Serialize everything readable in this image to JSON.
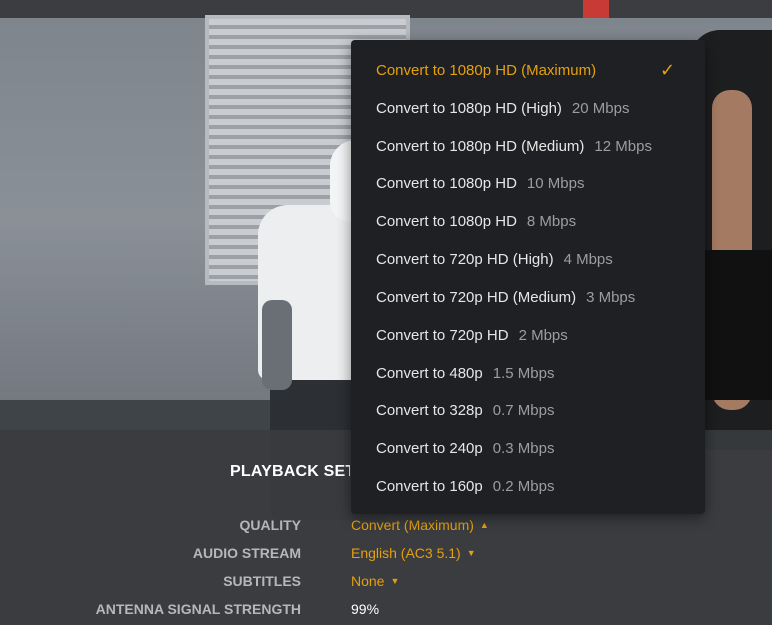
{
  "panel": {
    "title": "PLAYBACK SETTINGS",
    "rows": [
      {
        "label": "QUALITY",
        "value": "Convert (Maximum)",
        "caret": "up"
      },
      {
        "label": "AUDIO STREAM",
        "value": "English (AC3 5.1)",
        "caret": "down"
      },
      {
        "label": "SUBTITLES",
        "value": "None",
        "caret": "down"
      },
      {
        "label": "ANTENNA SIGNAL STRENGTH",
        "value": "99%"
      }
    ]
  },
  "quality_menu": {
    "items": [
      {
        "label": "Convert to 1080p HD (Maximum)",
        "rate": "",
        "selected": true
      },
      {
        "label": "Convert to 1080p HD (High)",
        "rate": "20 Mbps"
      },
      {
        "label": "Convert to 1080p HD (Medium)",
        "rate": "12 Mbps"
      },
      {
        "label": "Convert to 1080p HD",
        "rate": "10 Mbps"
      },
      {
        "label": "Convert to 1080p HD",
        "rate": "8 Mbps"
      },
      {
        "label": "Convert to 720p HD (High)",
        "rate": "4 Mbps"
      },
      {
        "label": "Convert to 720p HD (Medium)",
        "rate": "3 Mbps"
      },
      {
        "label": "Convert to 720p HD",
        "rate": "2 Mbps"
      },
      {
        "label": "Convert to 480p",
        "rate": "1.5 Mbps"
      },
      {
        "label": "Convert to 328p",
        "rate": "0.7 Mbps"
      },
      {
        "label": "Convert to 240p",
        "rate": "0.3 Mbps"
      },
      {
        "label": "Convert to 160p",
        "rate": "0.2 Mbps"
      }
    ],
    "check_icon": "checkmark-icon"
  },
  "colors": {
    "accent": "#e5a00d",
    "menu_bg": "#1f2023",
    "panel_bg": "#3a3c3f"
  }
}
